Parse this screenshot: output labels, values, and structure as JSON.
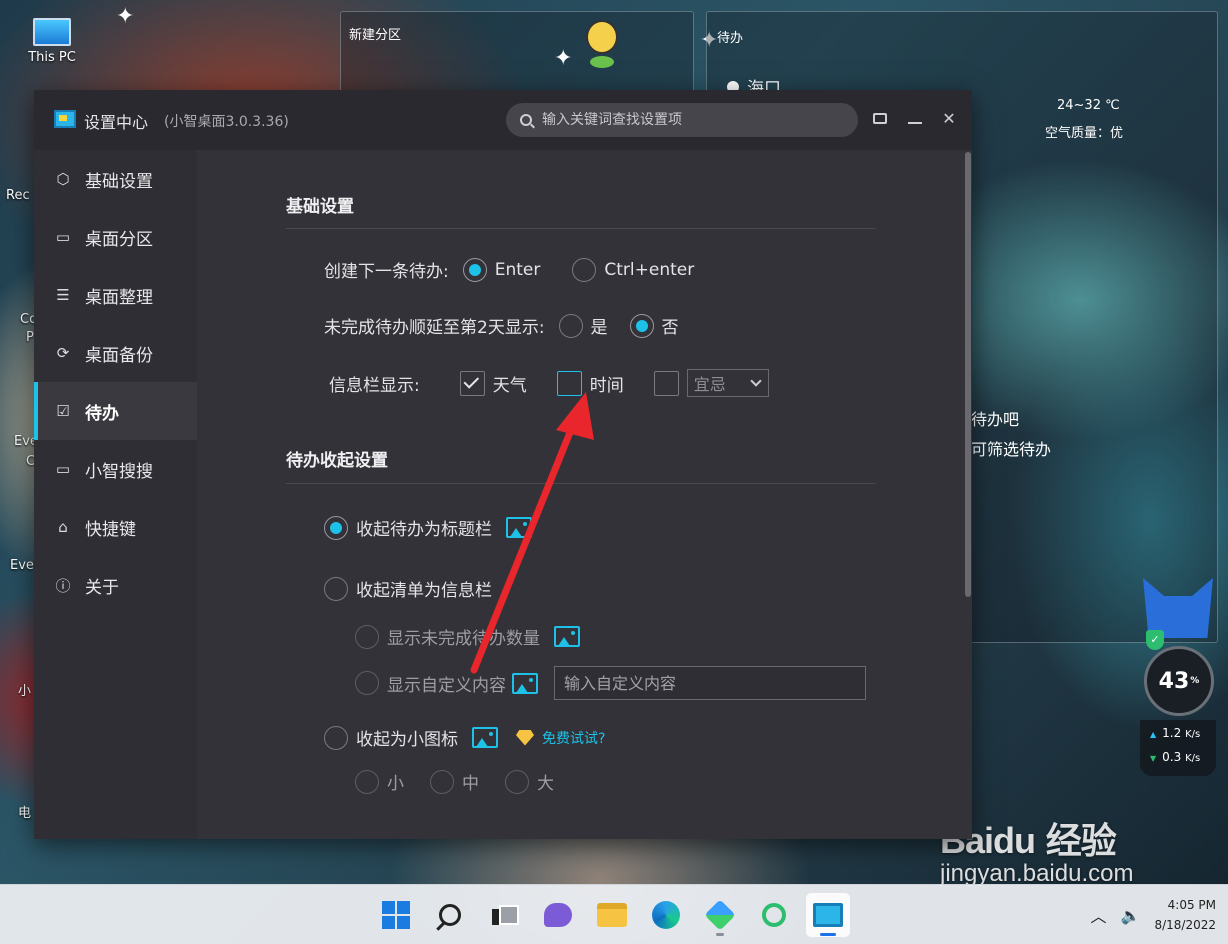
{
  "desktop": {
    "this_pc_label": "This PC",
    "left_fragments": [
      "Rec",
      "Co",
      "P",
      "Eve",
      "C",
      "Eve",
      "小",
      "电"
    ],
    "fence_new_title": "新建分区",
    "fence_todo_title": "待办",
    "weather_city": "海口",
    "weather_temp": "24~32 ℃",
    "weather_aq": "空气质量：优",
    "todo_hint_1": "待办吧",
    "todo_hint_2": "可筛选待办",
    "net_percent": "43",
    "net_percent_unit": "%",
    "net_up": "1.2",
    "net_up_unit": "K/s",
    "net_down": "0.3",
    "net_down_unit": "K/s",
    "watermark_brand": "Baidu",
    "watermark_cn": "经验",
    "watermark_url": "jingyan.baidu.com"
  },
  "taskbar": {
    "icons": [
      "start-icon",
      "search-icon",
      "task-view-icon",
      "chat-icon",
      "file-explorer-icon",
      "edge-icon",
      "app-diamond-icon",
      "app-ring-icon",
      "xiaozhi-desktop-icon"
    ],
    "time": "4:05 PM",
    "date": "8/18/2022"
  },
  "window": {
    "title": "设置中心",
    "version": "(小智桌面3.0.3.36)",
    "search_placeholder": "输入关键词查找设置项",
    "close_glyph": "✕"
  },
  "sidebar": {
    "items": [
      {
        "label": "基础设置",
        "icon": "hexagon-gear-icon"
      },
      {
        "label": "桌面分区",
        "icon": "monitor-icon"
      },
      {
        "label": "桌面整理",
        "icon": "list-icon"
      },
      {
        "label": "桌面备份",
        "icon": "sync-icon"
      },
      {
        "label": "待办",
        "icon": "calendar-check-icon",
        "active": true
      },
      {
        "label": "小智搜搜",
        "icon": "window-icon"
      },
      {
        "label": "快捷键",
        "icon": "mouse-icon"
      },
      {
        "label": "关于",
        "icon": "info-icon"
      }
    ]
  },
  "basic": {
    "section_title": "基础设置",
    "create_next_label": "创建下一条待办:",
    "create_opt1": "Enter",
    "create_opt2": "Ctrl+enter",
    "create_selected": "Enter",
    "defer_label": "未完成待办顺延至第2天显示:",
    "defer_yes": "是",
    "defer_no": "否",
    "defer_selected": "否",
    "infobar_label": "信息栏显示:",
    "infobar_weather": "天气",
    "infobar_weather_checked": true,
    "infobar_time": "时间",
    "infobar_time_checked": false,
    "infobar_almanac_checked": false,
    "almanac_select": "宜忌"
  },
  "collapse": {
    "section_title": "待办收起设置",
    "opt_titlebar": "收起待办为标题栏",
    "opt_infobar": "收起清单为信息栏",
    "sub_show_count": "显示未完成待办数量",
    "sub_show_custom": "显示自定义内容",
    "custom_placeholder": "输入自定义内容",
    "opt_icon": "收起为小图标",
    "free_trial": "免费试试?",
    "size_small": "小",
    "size_medium": "中",
    "size_large": "大",
    "selected": "收起待办为标题栏"
  },
  "colors": {
    "accent": "#1ec1e7",
    "window_bg": "#333238",
    "annotation_arrow": "#e8262b"
  }
}
